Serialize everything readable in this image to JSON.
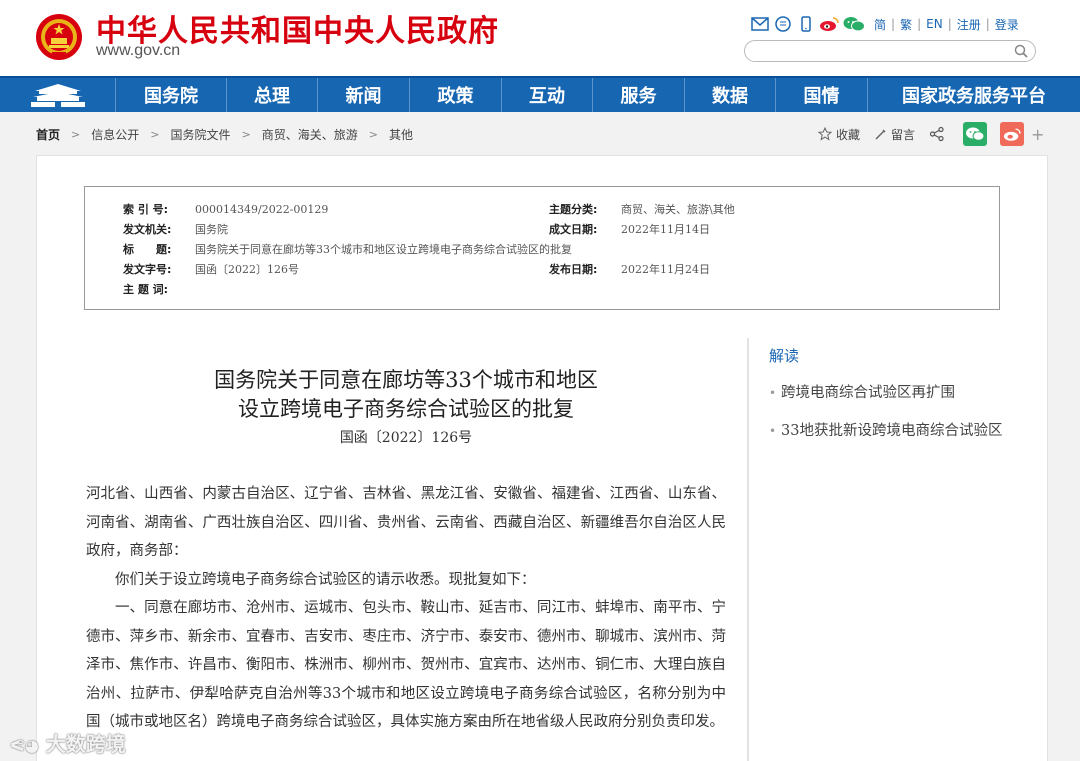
{
  "header": {
    "site_name": "中华人民共和国中央人民政府",
    "site_url": "www.gov.cn",
    "links": [
      "简",
      "繁",
      "EN",
      "注册",
      "登录"
    ],
    "icons": [
      "mail-icon",
      "message-icon",
      "mobile-icon",
      "weibo-icon",
      "wechat-icon"
    ],
    "search_placeholder": ""
  },
  "nav": {
    "items": [
      "国务院",
      "总理",
      "新闻",
      "政策",
      "互动",
      "服务",
      "数据",
      "国情",
      "国家政务服务平台"
    ]
  },
  "breadcrumb": [
    "首页",
    "信息公开",
    "国务院文件",
    "商贸、海关、旅游",
    "其他"
  ],
  "tools": {
    "favorite": "收藏",
    "comment": "留言"
  },
  "meta": {
    "index_label": "索 引 号:",
    "index_value": "000014349/2022-00129",
    "topic_label": "主题分类:",
    "topic_value": "商贸、海关、旅游\\其他",
    "issuer_label": "发文机关:",
    "issuer_value": "国务院",
    "written_label": "成文日期:",
    "written_value": "2022年11月14日",
    "title_label": "标　　题:",
    "title_value": "国务院关于同意在廊坊等33个城市和地区设立跨境电子商务综合试验区的批复",
    "docno_label": "发文字号:",
    "docno_value": "国函〔2022〕126号",
    "publish_label": "发布日期:",
    "publish_value": "2022年11月24日",
    "keywords_label": "主 题 词:",
    "keywords_value": ""
  },
  "article": {
    "title_line1": "国务院关于同意在廊坊等33个城市和地区",
    "title_line2": "设立跨境电子商务综合试验区的批复",
    "doc_number": "国函〔2022〕126号",
    "addressee": "河北省、山西省、内蒙古自治区、辽宁省、吉林省、黑龙江省、安徽省、福建省、江西省、山东省、河南省、湖南省、广西壮族自治区、四川省、贵州省、云南省、西藏自治区、新疆维吾尔自治区人民政府，商务部：",
    "para1": "你们关于设立跨境电子商务综合试验区的请示收悉。现批复如下：",
    "para2": "一、同意在廊坊市、沧州市、运城市、包头市、鞍山市、延吉市、同江市、蚌埠市、南平市、宁德市、萍乡市、新余市、宜春市、吉安市、枣庄市、济宁市、泰安市、德州市、聊城市、滨州市、菏泽市、焦作市、许昌市、衡阳市、株洲市、柳州市、贺州市、宜宾市、达州市、铜仁市、大理白族自治州、拉萨市、伊犁哈萨克自治州等33个城市和地区设立跨境电子商务综合试验区，名称分别为中国（城市或地区名）跨境电子商务综合试验区，具体实施方案由所在地省级人民政府分别负责印发。"
  },
  "sidebar": {
    "title": "解读",
    "items": [
      "跨境电商综合试验区再扩围",
      "33地获批新设跨境电商综合试验区"
    ]
  },
  "watermark": "大数跨境"
}
